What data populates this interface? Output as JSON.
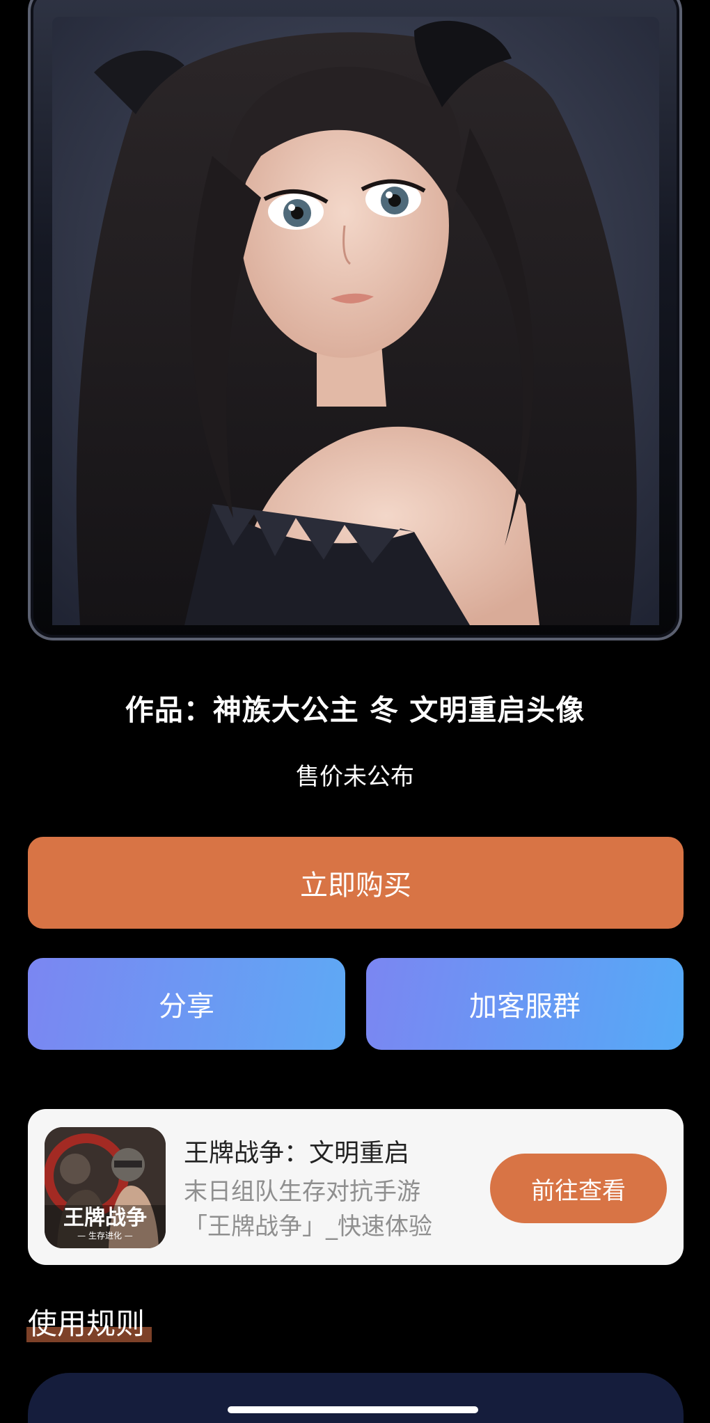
{
  "artwork": {
    "title": "作品：神族大公主 冬 文明重启头像",
    "price_text": "售价未公布"
  },
  "actions": {
    "buy_label": "立即购买",
    "share_label": "分享",
    "group_label": "加客服群"
  },
  "game_card": {
    "name": "王牌战争：文明重启",
    "description": "末日组队生存对抗手游「王牌战争」_快速体验",
    "goto_label": "前往查看",
    "icon_logo_text": "王牌战争",
    "icon_sub_text": "— 生存进化 —"
  },
  "rules": {
    "heading": "使用规则"
  },
  "colors": {
    "accent": "#d87445",
    "gradient_start": "#7b86f2",
    "gradient_end": "#5ea9f4",
    "card_bg": "#f6f6f6",
    "page_bg": "#000000"
  }
}
